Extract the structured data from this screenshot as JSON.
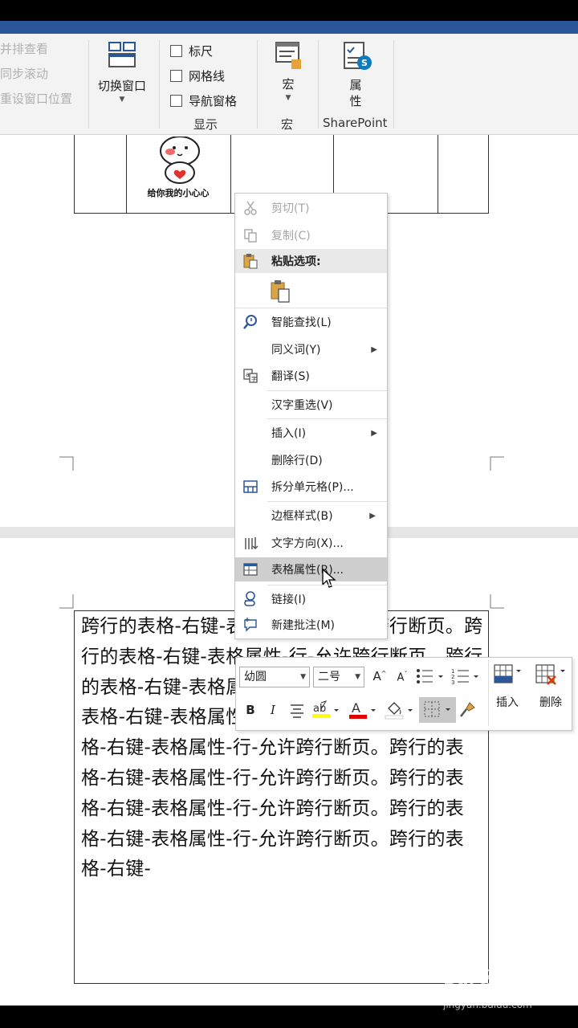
{
  "ribbon": {
    "view_items": [
      "并排查看",
      "同步滚动",
      "重设窗口位置"
    ],
    "switch_window": "切换窗口",
    "show_checks": [
      "标尺",
      "网格线",
      "导航窗格"
    ],
    "show_group": "显示",
    "macro_btn": "宏",
    "macro_group": "宏",
    "props_btn": "属性",
    "sharepoint_group": "SharePoint"
  },
  "sticker_caption": "给你我的小心心",
  "context_menu": {
    "cut": "剪切(T)",
    "copy": "复制(C)",
    "paste_options": "粘贴选项:",
    "smart_lookup": "智能查找(L)",
    "synonyms": "同义词(Y)",
    "translate": "翻译(S)",
    "reconvert": "汉字重选(V)",
    "insert": "插入(I)",
    "delete_row": "删除行(D)",
    "split_cells": "拆分单元格(P)...",
    "border_styles": "边框样式(B)",
    "text_direction": "文字方向(X)...",
    "table_properties": "表格属性(R)...",
    "link": "链接(I)",
    "new_comment": "新建批注(M)"
  },
  "mini_toolbar": {
    "font_name": "幼圆",
    "font_size": "二号",
    "insert_label": "插入",
    "delete_label": "删除"
  },
  "table_text": "跨行的表格-右键-表格属性-行-允许跨行断页。跨行的表格-右键-表格属性-行-允许跨行断页。跨行的表格-右键-表格属性-行-允许跨行断页。跨行的表格-右键-表格属性-行-允许跨行断页。跨行的表格-右键-表格属性-行-允许跨行断页。跨行的表格-右键-表格属性-行-允许跨行断页。跨行的表格-右键-表格属性-行-允许跨行断页。跨行的表格-右键-表格属性-行-允许跨行断页。跨行的表格-右键-",
  "watermark": "Bai 经验",
  "watermark_url": "jingyan.baidu.com",
  "colors": {
    "accent": "#2b579a",
    "highlight_yellow": "#ffff00",
    "font_red": "#e00000"
  }
}
